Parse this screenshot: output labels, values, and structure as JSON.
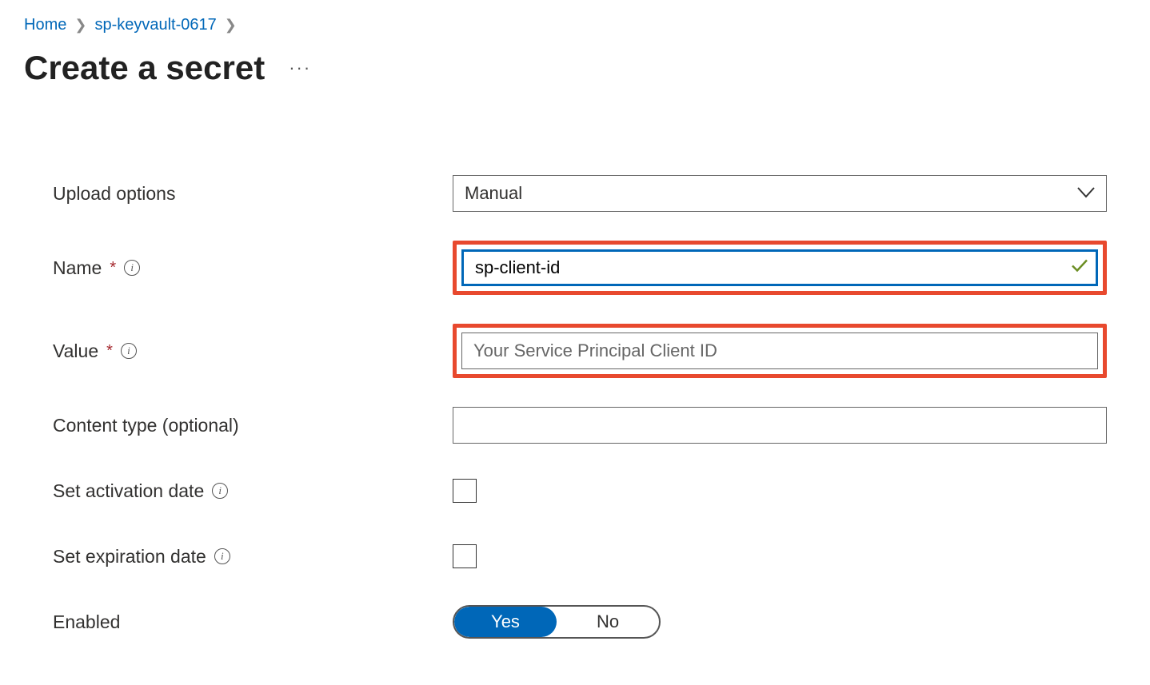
{
  "breadcrumb": {
    "home": "Home",
    "item1": "sp-keyvault-0617"
  },
  "page": {
    "title": "Create a secret",
    "more": "···"
  },
  "form": {
    "upload_options": {
      "label": "Upload options",
      "value": "Manual"
    },
    "name": {
      "label": "Name",
      "value": "sp-client-id"
    },
    "value": {
      "label": "Value",
      "placeholder": "Your Service Principal Client ID"
    },
    "content_type": {
      "label": "Content type (optional)",
      "value": ""
    },
    "activation": {
      "label": "Set activation date"
    },
    "expiration": {
      "label": "Set expiration date"
    },
    "enabled": {
      "label": "Enabled",
      "yes": "Yes",
      "no": "No"
    }
  }
}
